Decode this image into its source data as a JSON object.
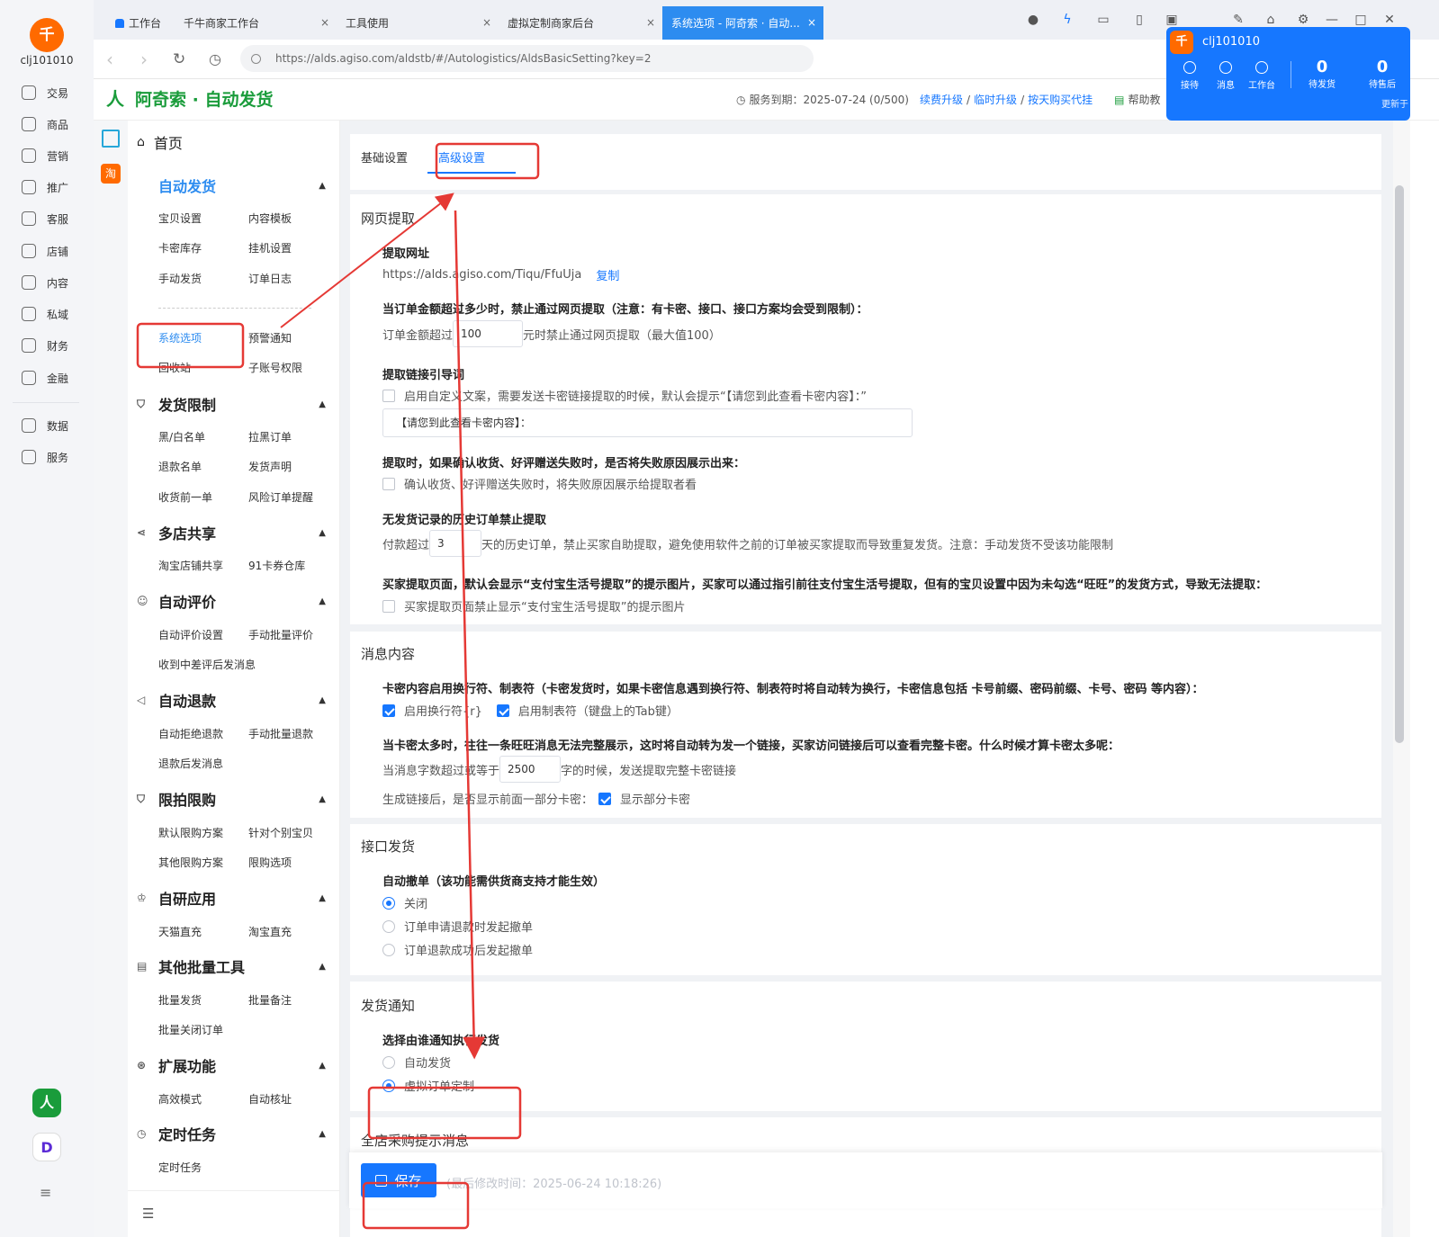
{
  "rail": {
    "logo_text": "千",
    "username": "clj101010",
    "items": [
      "交易",
      "商品",
      "营销",
      "推广",
      "客服",
      "店铺",
      "内容",
      "私域",
      "财务",
      "金融",
      "数据",
      "服务"
    ],
    "menu_icon": "≡"
  },
  "browser": {
    "tabs": [
      "工作台",
      "千牛商家工作台",
      "工具使用",
      "虚拟定制商家后台",
      "系统选项 - 阿奇索 · 自动..."
    ],
    "close_glyph": "×",
    "url": "https://alds.agiso.com/aldstb/#/Autologistics/AldsBasicSetting?key=2"
  },
  "header": {
    "brand": "阿奇索 · 自动发货",
    "service_label": "服务到期：2025-07-24 (0/500)",
    "links": [
      "续费升级",
      "临时升级",
      "按天购买代挂"
    ],
    "help": "帮助教"
  },
  "popup": {
    "name": "clj101010",
    "items": [
      "接待",
      "消息",
      "工作台"
    ],
    "counts": [
      {
        "value": "0",
        "label": "待发货"
      },
      {
        "value": "0",
        "label": "待售后"
      }
    ],
    "more": "更新于"
  },
  "sidestrip": {
    "taobao": "淘"
  },
  "sidebar": {
    "home": "首页",
    "groups": [
      {
        "title": "自动发货",
        "links": [
          "宝贝设置",
          "内容模板",
          "卡密库存",
          "挂机设置",
          "手动发货",
          "订单日志",
          "系统选项",
          "预警通知",
          "回收站",
          "子账号权限"
        ]
      },
      {
        "title": "发货限制",
        "links": [
          "黑/白名单",
          "拉黑订单",
          "退款名单",
          "发货声明",
          "收货前一单",
          "风险订单提醒"
        ]
      },
      {
        "title": "多店共享",
        "links": [
          "淘宝店铺共享",
          "91卡券仓库"
        ]
      },
      {
        "title": "自动评价",
        "links": [
          "自动评价设置",
          "手动批量评价",
          "收到中差评后发消息"
        ]
      },
      {
        "title": "自动退款",
        "links": [
          "自动拒绝退款",
          "手动批量退款",
          "退款后发消息"
        ]
      },
      {
        "title": "限拍限购",
        "links": [
          "默认限购方案",
          "针对个别宝贝",
          "其他限购方案",
          "限购选项"
        ]
      },
      {
        "title": "自研应用",
        "links": [
          "天猫直充",
          "淘宝直充"
        ]
      },
      {
        "title": "其他批量工具",
        "links": [
          "批量发货",
          "批量备注",
          "批量关闭订单"
        ]
      },
      {
        "title": "扩展功能",
        "links": [
          "高效模式",
          "自动核址"
        ]
      },
      {
        "title": "定时任务",
        "links": [
          "定时任务"
        ]
      }
    ]
  },
  "settings_tabs": [
    "基础设置",
    "高级设置"
  ],
  "web_extract": {
    "title": "网页提取",
    "url_label": "提取网址",
    "url_value": "https://alds.agiso.com/Tiqu/FfuUja",
    "copy": "复制",
    "amount_q": "当订单金额超过多少时，禁止通过网页提取（注意：有卡密、接口、接口方案均会受到限制）：",
    "amount_pre": "订单金额超过",
    "amount_value": "100",
    "amount_post": "元时禁止通过网页提取（最大值100）",
    "guide_q": "提取链接引导词",
    "guide_cb": "启用自定义文案，需要发送卡密链接提取的时候，默认会提示“【请您到此查看卡密内容】：”",
    "guide_value": "【请您到此查看卡密内容】：",
    "fail_q": "提取时，如果确认收货、好评赠送失败时，是否将失败原因展示出来：",
    "fail_cb": "确认收货、好评赠送失败时，将失败原因展示给提取者看",
    "hist_q": "无发货记录的历史订单禁止提取",
    "hist_pre": "付款超过",
    "hist_value": "3",
    "hist_post": "天的历史订单，禁止买家自助提取，避免使用软件之前的订单被买家提取而导致重复发货。注意：手动发货不受该功能限制",
    "alipay_q": "买家提取页面，默认会显示“支付宝生活号提取”的提示图片，买家可以通过指引前往支付宝生活号提取，但有的宝贝设置中因为未勾选“旺旺”的发货方式，导致无法提取：",
    "alipay_cb": "买家提取页面禁止显示“支付宝生活号提取”的提示图片"
  },
  "message": {
    "title": "消息内容",
    "q1": "卡密内容启用换行符、制表符（卡密发货时，如果卡密信息遇到换行符、制表符时将自动转为换行，卡密信息包括 卡号前缀、密码前缀、卡号、密码 等内容）：",
    "cb1": "启用换行符{r}",
    "cb2": "启用制表符（键盘上的Tab键）",
    "q2": "当卡密太多时，往往一条旺旺消息无法完整展示，这时将自动转为发一个链接，买家访问链接后可以查看完整卡密。什么时候才算卡密太多呢：",
    "len_pre": "当消息字数超过或等于",
    "len_value": "2500",
    "len_post": "字的时候，发送提取完整卡密链接",
    "partial_pre": "生成链接后，是否显示前面一部分卡密：",
    "partial_cb": "显示部分卡密"
  },
  "interface": {
    "title": "接口发货",
    "q": "自动撤单（该功能需供货商支持才能生效）",
    "options": [
      "关闭",
      "订单申请退款时发起撤单",
      "订单退款成功后发起撤单"
    ],
    "selected": 0
  },
  "notify": {
    "title": "发货通知",
    "q": "选择由谁通知执行发货",
    "options": [
      "自动发货",
      "虚拟订单定制"
    ],
    "selected": 1
  },
  "purchase": {
    "title": "全店采购提示消息"
  },
  "save": {
    "label": "保存",
    "time": "(最后修改时间：2025-06-24 10:18:26)"
  },
  "colors": {
    "accent": "#1677ff",
    "brand_green": "#1a9c3b",
    "annotation_red": "#e53935",
    "orange": "#ff6a00"
  }
}
